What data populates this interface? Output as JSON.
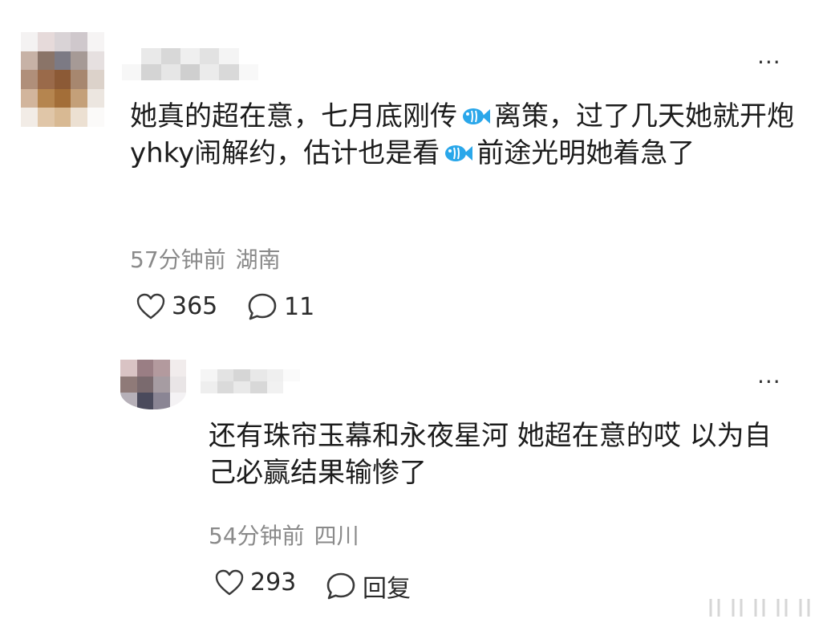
{
  "colors": {
    "text": "#1c1c1c",
    "meta": "#8a8a8a",
    "emoji_blue": "#2aa7ea"
  },
  "comment": {
    "more_label": "···",
    "text_parts": [
      "她真的超在意，七月底刚传",
      "离策，过了几天她就开炮yhky闹解约，估计也是看",
      "前途光明她着急了"
    ],
    "emoji_icon": "fish-emoji-icon",
    "time": "57分钟前",
    "location": "湖南",
    "likes": "365",
    "replies": "11"
  },
  "reply": {
    "more_label": "···",
    "text": "还有珠帘玉幕和永夜星河 她超在意的哎 以为自己必赢结果输惨了",
    "time": "54分钟前",
    "location": "四川",
    "likes": "293",
    "reply_label": "回复"
  }
}
